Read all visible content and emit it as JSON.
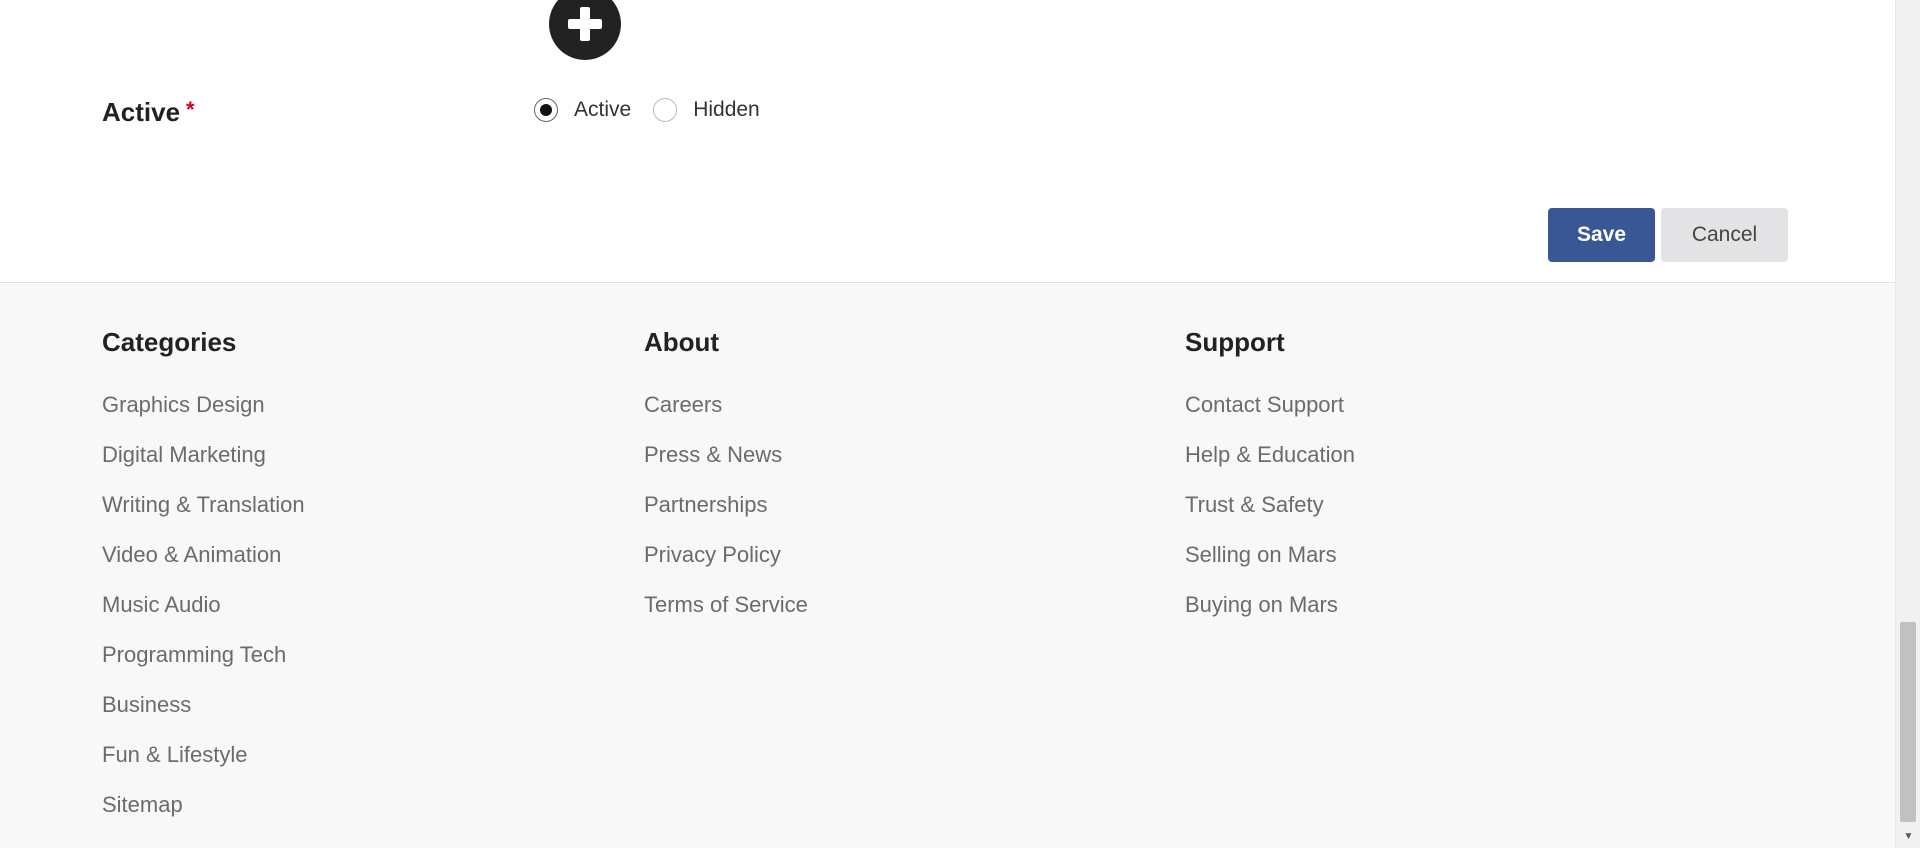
{
  "form": {
    "add_icon": "plus-circle-icon",
    "active_label": "Active",
    "required_mark": "*",
    "radio_options": [
      {
        "label": "Active",
        "checked": true
      },
      {
        "label": "Hidden",
        "checked": false
      }
    ],
    "save_label": "Save",
    "cancel_label": "Cancel"
  },
  "footer": {
    "columns": [
      {
        "title": "Categories",
        "links": [
          "Graphics Design",
          "Digital Marketing",
          "Writing & Translation",
          "Video & Animation",
          "Music Audio",
          "Programming Tech",
          "Business",
          "Fun & Lifestyle",
          "Sitemap"
        ]
      },
      {
        "title": "About",
        "links": [
          "Careers",
          "Press & News",
          "Partnerships",
          "Privacy Policy",
          "Terms of Service"
        ]
      },
      {
        "title": "Support",
        "links": [
          "Contact Support",
          "Help & Education",
          "Trust & Safety",
          "Selling on Mars",
          "Buying on Mars"
        ]
      }
    ]
  },
  "colors": {
    "save_button": "#3a5795",
    "cancel_button": "#e3e3e5",
    "footer_bg": "#f8f8f8",
    "required": "#d0021b"
  }
}
